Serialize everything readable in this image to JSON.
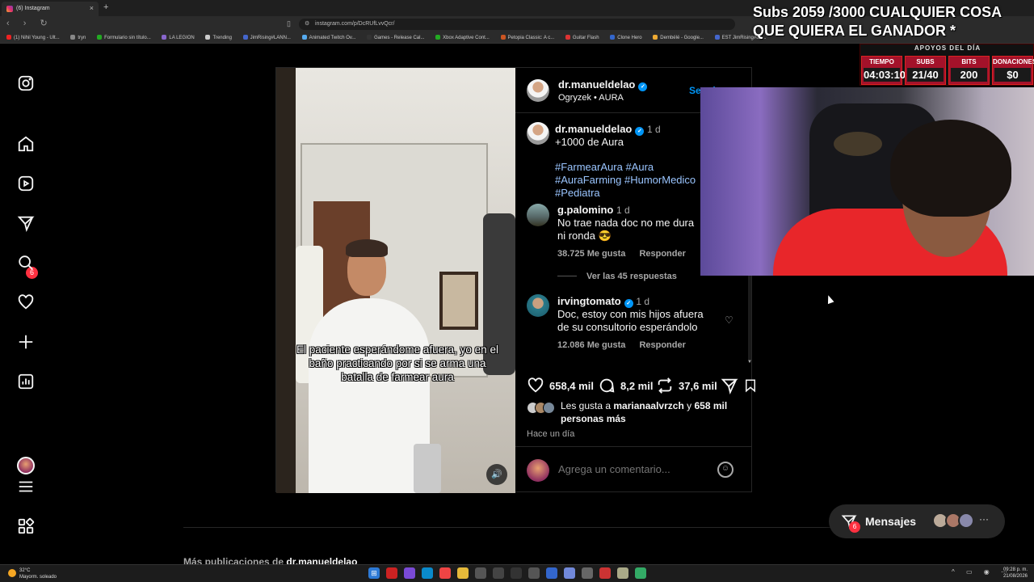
{
  "browser": {
    "tab_title": "(6) Instagram",
    "url": "instagram.com/p/DcRUfLvvQcr/",
    "bookmarks": [
      "(1) Nihil Young - Ult...",
      "tryn",
      "Formulario sin título...",
      "LA LEGION",
      "Trending",
      "JimRising#LANN...",
      "Animated Twitch Ov...",
      "Games - Release Cal...",
      "Xbox Adaptive Cont...",
      "Petopia Classic: A c...",
      "Guitar Flash",
      "Clone Hero",
      "Dembélé - Google...",
      "EST JimRising#LA..."
    ]
  },
  "stream": {
    "title": "Subs 2059 /3000 CUALQUIER COSA QUE QUIERA EL GANADOR *",
    "apoyos_header": "APOYOS DEL DÍA",
    "boxes": [
      {
        "label": "TIEMPO",
        "value": "04:03:10"
      },
      {
        "label": "SUBS",
        "value": "21/40"
      },
      {
        "label": "BITS",
        "value": "200"
      },
      {
        "label": "DONACIONES",
        "value": "$0"
      }
    ]
  },
  "nav": {
    "badge_count": "6"
  },
  "post": {
    "author": "dr.manueldelao",
    "audio": "Ogryzek • AURA",
    "follow_label": "Seguir",
    "video_caption": "El paciente esperándome afuera, yo en el baño practicando por si se arma una batalla de farmear aura",
    "caption_author": "dr.manueldelao",
    "caption_time": "1 d",
    "caption_text": "+1000 de Aura",
    "hashtags": [
      "#FarmearAura",
      "#Aura",
      "#AuraFarming",
      "#HumorMedico",
      "#Pediatra"
    ],
    "comments": [
      {
        "user": "g.palomino",
        "time": "1 d",
        "text": "No trae nada doc no me dura ni ronda 😎",
        "likes": "38.725 Me gusta",
        "reply": "Responder"
      },
      {
        "user": "irvingtomato",
        "time": "1 d",
        "text": "Doc, estoy con mis hijos afuera de su consultorio esperándolo",
        "likes": "12.086 Me gusta",
        "reply": "Responder"
      }
    ],
    "view_replies": "Ver las 45 respuestas",
    "like_count": "658,4 mil",
    "comment_count": "8,2 mil",
    "repost_count": "37,6 mil",
    "liked_by_prefix": "Les gusta a",
    "liked_by_user": "marianaalvrzch",
    "liked_by_suffix": "y",
    "liked_by_others": "658 mil personas más",
    "time_ago": "Hace un día",
    "comment_placeholder": "Agrega un comentario..."
  },
  "footer": {
    "more_posts_prefix": "Más publicaciones de",
    "more_posts_user": "dr.manueldelao"
  },
  "messages": {
    "label": "Mensajes",
    "badge": "6"
  },
  "taskbar": {
    "temp": "32°C",
    "weather": "Mayorm. soleado",
    "time": "09:28 p. m.",
    "date": "21/08/2026"
  }
}
